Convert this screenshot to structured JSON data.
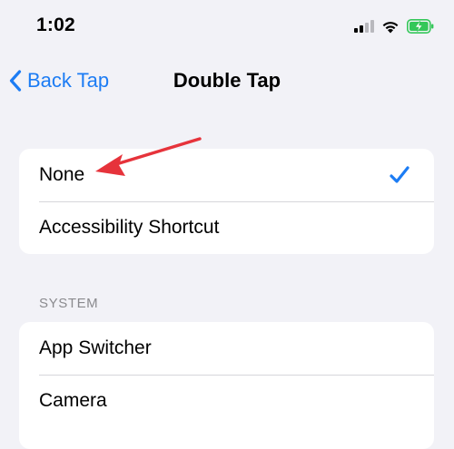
{
  "status_bar": {
    "time": "1:02"
  },
  "nav": {
    "back_label": "Back Tap",
    "title": "Double Tap"
  },
  "options": [
    {
      "label": "None",
      "selected": true
    },
    {
      "label": "Accessibility Shortcut",
      "selected": false
    }
  ],
  "system_section": {
    "header": "SYSTEM",
    "items": [
      {
        "label": "App Switcher"
      },
      {
        "label": "Camera"
      }
    ]
  },
  "colors": {
    "accent": "#1c7cf4",
    "arrow": "#e6333b",
    "battery": "#34c759",
    "background": "#f2f2f7"
  },
  "icons": {
    "signal": "cellular-signal-icon",
    "wifi": "wifi-icon",
    "battery": "battery-charging-icon",
    "back": "chevron-left-icon",
    "check": "checkmark-icon"
  }
}
